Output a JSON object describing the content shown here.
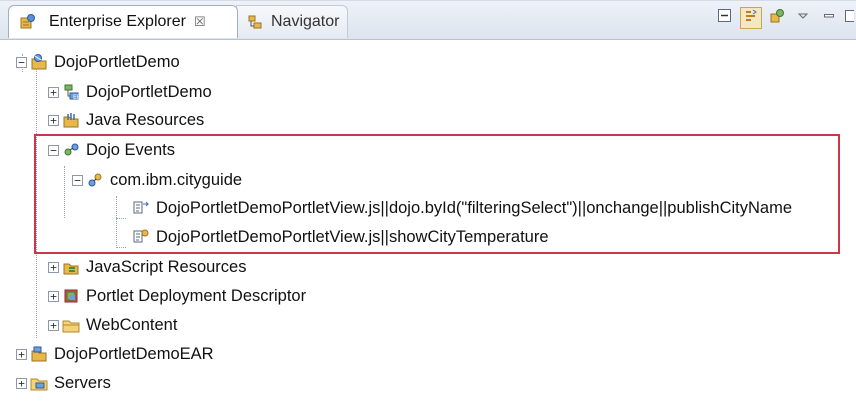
{
  "tabs": [
    {
      "label": "Enterprise Explorer",
      "close": "☒"
    },
    {
      "label": "Navigator"
    }
  ],
  "toolbar": {
    "buttons": [
      "collapse-all-icon",
      "link-with-editor-icon",
      "filter-icon",
      "view-menu-icon",
      "minimize-icon",
      "maximize-icon"
    ]
  },
  "tree": {
    "project": "DojoPortletDemo",
    "deployment_descriptor": "DojoPortletDemo",
    "java_resources": "Java Resources",
    "dojo_events": "Dojo Events",
    "package": "com.ibm.cityguide",
    "event_1": "DojoPortletDemoPortletView.js||dojo.byId(\"filteringSelect\")||onchange||publishCityName",
    "event_2": "DojoPortletDemoPortletView.js||showCityTemperature",
    "javascript_resources": "JavaScript Resources",
    "portlet_dd": "Portlet Deployment Descriptor",
    "webcontent": "WebContent",
    "ear": "DojoPortletDemoEAR",
    "servers": "Servers"
  },
  "colors": {
    "highlight": "#c9384a",
    "folder": "#e8b94a",
    "accent": "#3d6fb6"
  }
}
